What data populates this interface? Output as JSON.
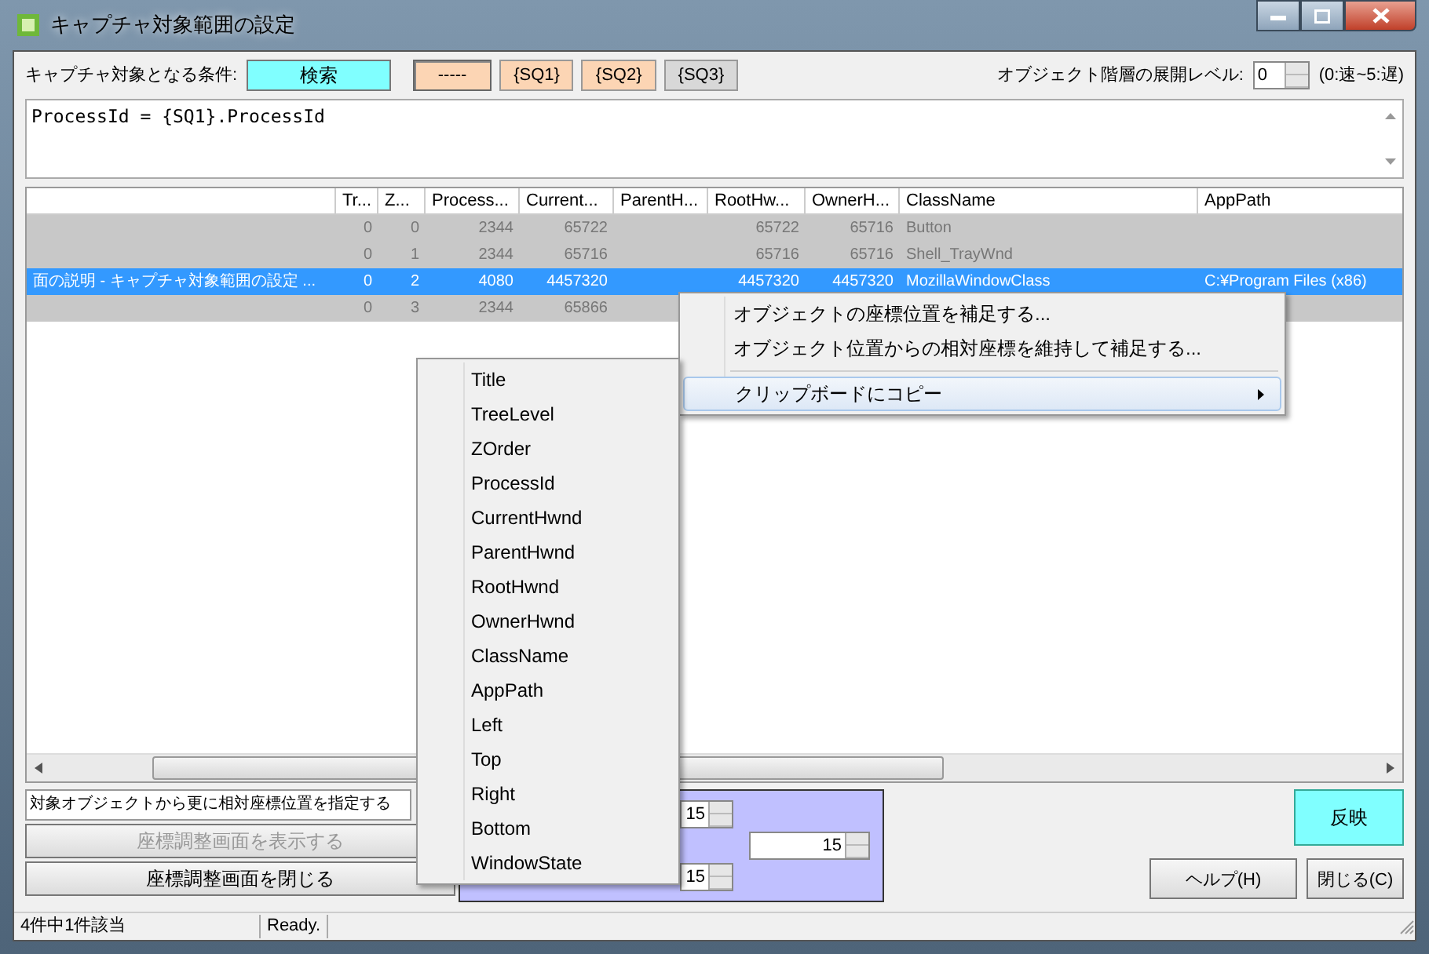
{
  "window": {
    "title": "キャプチャ対象範囲の設定"
  },
  "condition": {
    "label": "キャプチャ対象となる条件:",
    "search_button": "検索",
    "queries": [
      {
        "label": "-----",
        "color": "#fcd5b4",
        "selected": true
      },
      {
        "label": "{SQ1}",
        "color": "#fcd5b4",
        "selected": false
      },
      {
        "label": "{SQ2}",
        "color": "#fcd5b4",
        "selected": false
      },
      {
        "label": "{SQ3}",
        "color": "#d8d8d8",
        "selected": false
      }
    ]
  },
  "depth": {
    "label": "オブジェクト階層の展開レベル:",
    "value": "0",
    "hint": "(0:速~5:遅)"
  },
  "query_text": "ProcessId = {SQ1}.ProcessId",
  "table": {
    "columns": [
      "",
      "Tr...",
      "Z...",
      "Process...",
      "Current...",
      "ParentH...",
      "RootHw...",
      "OwnerH...",
      "ClassName",
      "AppPath"
    ],
    "rows": [
      {
        "selected": false,
        "cells": [
          "",
          "0",
          "0",
          "2344",
          "65722",
          "",
          "65722",
          "65716",
          "Button",
          ""
        ]
      },
      {
        "selected": false,
        "cells": [
          "",
          "0",
          "1",
          "2344",
          "65716",
          "",
          "65716",
          "65716",
          "Shell_TrayWnd",
          ""
        ]
      },
      {
        "selected": true,
        "cells": [
          "面の説明 - キャプチャ対象範囲の設定 ...",
          "0",
          "2",
          "4080",
          "4457320",
          "",
          "4457320",
          "4457320",
          "MozillaWindowClass",
          "C:¥Program Files (x86)"
        ]
      },
      {
        "selected": false,
        "cells": [
          "",
          "0",
          "3",
          "2344",
          "65866",
          "",
          "",
          "",
          "",
          ""
        ]
      }
    ]
  },
  "context_menu": [
    {
      "kind": "item",
      "label": "オブジェクトの座標位置を補足する...",
      "selected": false
    },
    {
      "kind": "item",
      "label": "オブジェクト位置からの相対座標を維持して補足する...",
      "selected": false
    },
    {
      "kind": "separator"
    },
    {
      "kind": "submenu",
      "label": "クリップボードにコピー",
      "selected": true
    }
  ],
  "submenu": [
    "Title",
    "TreeLevel",
    "ZOrder",
    "ProcessId",
    "CurrentHwnd",
    "ParentHwnd",
    "RootHwnd",
    "OwnerHwnd",
    "ClassName",
    "AppPath",
    "Left",
    "Top",
    "Right",
    "Bottom",
    "WindowState"
  ],
  "relative_field": "対象オブジェクトから更に相対座標位置を指定する",
  "show_button": {
    "label": "座標調整画面を表示する",
    "disabled": true
  },
  "close_adjust_button": {
    "label": "座標調整画面を閉じる",
    "disabled": false
  },
  "offsets": [
    "15",
    "15",
    "15"
  ],
  "apply_button": "反映",
  "help_button": "ヘルプ(H)",
  "close_button": "閉じる(C)",
  "status_bar": [
    "4件中1件該当",
    "Ready."
  ]
}
